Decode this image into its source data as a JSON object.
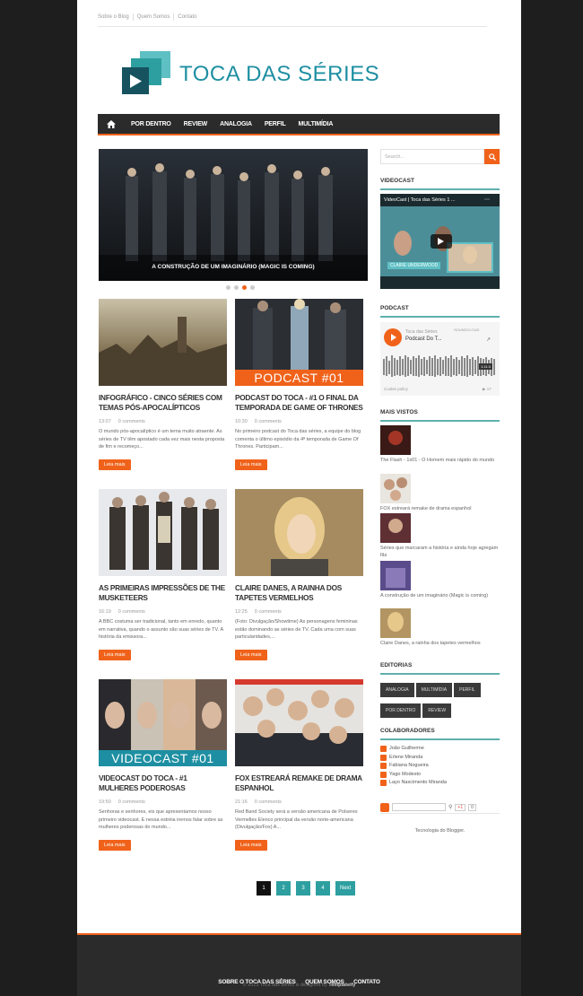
{
  "top_links": [
    "Sobre o Blog",
    "Quem Somos",
    "Contato"
  ],
  "logo": {
    "text": "TOCA DAS SÉRIES"
  },
  "nav": [
    "POR DENTRO",
    "REVIEW",
    "ANALOGIA",
    "PERFIL",
    "MULTIMÍDIA"
  ],
  "slider": {
    "caption": "A CONSTRUÇÃO DE UM IMAGINÁRIO (MAGIC IS COMING)",
    "dots": 4,
    "active": 2
  },
  "posts": [
    {
      "title": "INFOGRÁFICO - CINCO SÉRIES COM TEMAS PÓS-APOCALÍPTICOS",
      "time": "13:07",
      "comments": "0 comments",
      "excerpt": "O mundo pós-apocalíptico é um tema muito atraente. As séries de TV têm apostado cada vez mais nesta proposta de fim e recomeço...",
      "more": "Leia mais",
      "badge": ""
    },
    {
      "title": "PODCAST DO TOCA - #1 O FINAL DA TEMPORADA DE GAME OF THRONES",
      "time": "10:30",
      "comments": "0 comments",
      "excerpt": "No primeiro podcast do Toca das séries, a equipe do blog comenta o último episódio da 4ª temporada de Game Of Thrones.  Participam...",
      "more": "Leia mais",
      "badge": "PODCAST #01"
    },
    {
      "title": "AS PRIMEIRAS IMPRESSÕES DE THE MUSKETEERS",
      "time": "16:19",
      "comments": "0 comments",
      "excerpt": "A BBC costuma ser tradicional, tanto em enredo, quanto em narrativa, quando o assunto são suas séries de TV. A história da emissora...",
      "more": "Leia mais",
      "badge": ""
    },
    {
      "title": "CLAIRE DANES, A RAINHA DOS TAPETES VERMELHOS",
      "time": "12:25",
      "comments": "0 comments",
      "excerpt": "(Foto: Divulgação/Showtime) As personagens femininas estão dominando as séries de TV. Cada uma com suas particularidades,...",
      "more": "Leia mais",
      "badge": ""
    },
    {
      "title": "VIDEOCAST DO TOCA - #1 MULHERES PODEROSAS",
      "time": "19:50",
      "comments": "0 comments",
      "excerpt": "Senhoras e senhores, eis que apresentamos nosso primeiro videocast. E nessa estréia iremos falar sobre as mulheres poderosas do mundo...",
      "more": "Leia mais",
      "badge": "VIDEOCAST #01"
    },
    {
      "title": "FOX ESTREARÁ REMAKE DE DRAMA ESPANHOL",
      "time": "21:16",
      "comments": "0 comments",
      "excerpt": "Red Band Society será a versão americana de Polseres Vermelles Elenco principal da versão norte-americana (Divulgação/Fox) A...",
      "more": "Leia mais",
      "badge": ""
    }
  ],
  "pagination": [
    "1",
    "2",
    "3",
    "4",
    "Next"
  ],
  "sidebar": {
    "search_placeholder": "Search...",
    "videocast_title": "VIDEOCAST",
    "video_label": "VideoCast | Toca das Séries 1 ...",
    "video_name_tag": "CLAIRE UNDERWOOD",
    "podcast_title": "PODCAST",
    "podcast_artist": "Toca das Séries",
    "podcast_track": "Podcast Do T...",
    "podcast_brand": "SOUNDCLOUD",
    "podcast_time": "1:11:3",
    "podcast_policy": "Cookie policy",
    "podcast_plays": "▶ 17",
    "mais_vistos_title": "MAIS VISTOS",
    "mais_vistos": [
      "The Flash - 1x01 - O Homem mais rápido do mundo",
      "FOX estreará remake de drama espanhol",
      "Séries que marcaram a história e ainda hoje agregam fãs",
      "A construção de um imaginário (Magic is coming)",
      "Claire Danes, a rainha dos tapetes vermelhos"
    ],
    "editorias_title": "EDITORIAS",
    "editorias": [
      "ANALOGIA",
      "MULTIMÍDIA",
      "PERFIL",
      "POR DENTRO",
      "REVIEW"
    ],
    "colaboradores_title": "COLABORADORES",
    "colaboradores": [
      "João Guilherme",
      "Erlene Miranda",
      "Fabiana Nogueira",
      "Yago Modesto",
      "Layo Nascimento Miranda"
    ],
    "gplus": "+1",
    "gplus_count": "0",
    "blogger": "Tecnologia do Blogger."
  },
  "footer": {
    "links": [
      "SOBRE O TOCA DAS SÉRIES",
      "QUEM SOMOS",
      "CONTATO"
    ],
    "credit_prefix": "© 2013 Toca das séries is designed by",
    "credit_brand": "Templateify"
  },
  "colors": {
    "accent": "#f0621a",
    "teal": "#2e9fa0",
    "dark": "#2b2b2b"
  }
}
